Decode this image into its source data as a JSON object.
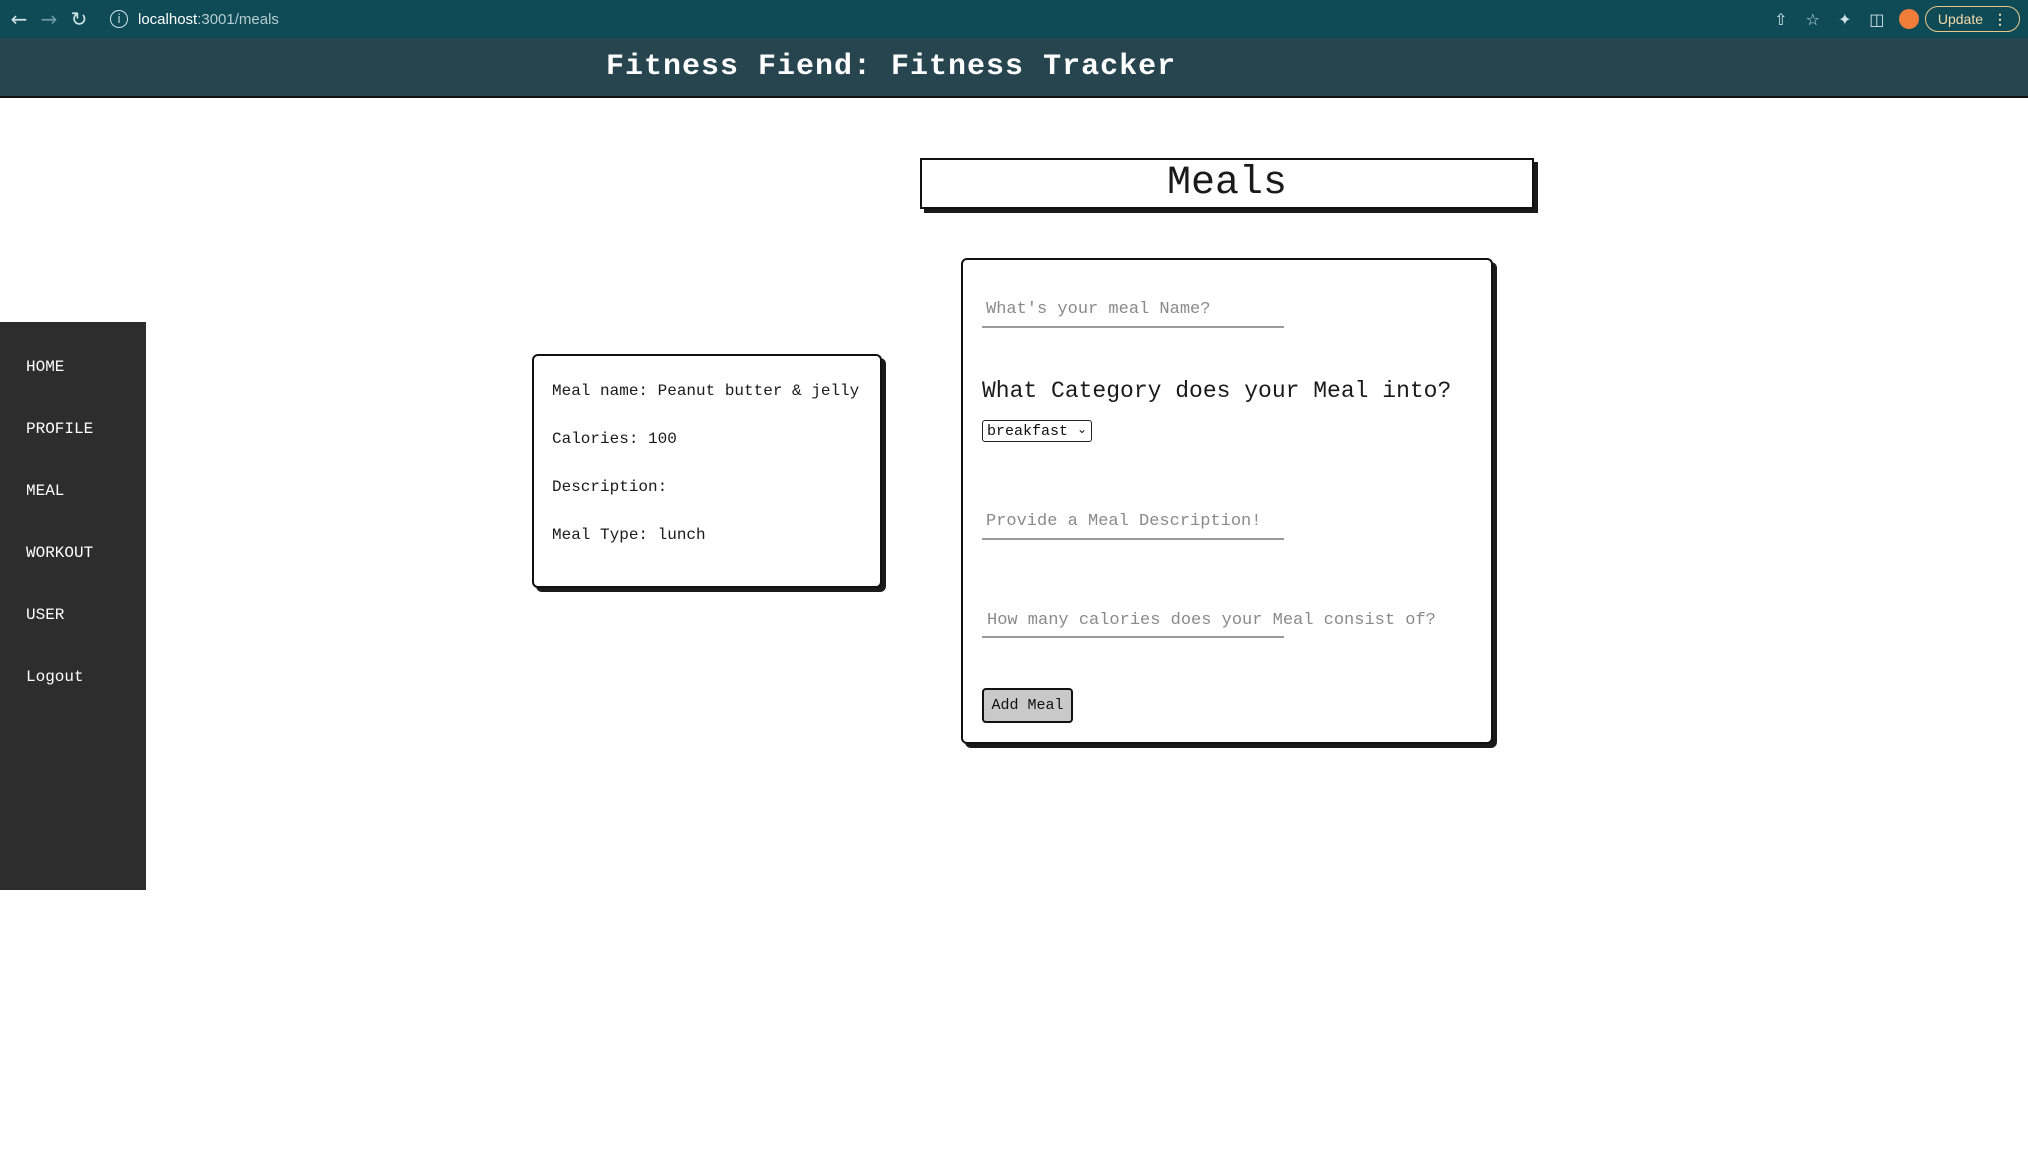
{
  "browser": {
    "url_host": "localhost",
    "url_path": ":3001/meals",
    "update_label": "Update"
  },
  "app": {
    "title": "Fitness Fiend: Fitness Tracker"
  },
  "sidebar": {
    "items": [
      {
        "label": "HOME"
      },
      {
        "label": "PROFILE"
      },
      {
        "label": "MEAL"
      },
      {
        "label": "WORKOUT"
      },
      {
        "label": "USER"
      },
      {
        "label": "Logout"
      }
    ]
  },
  "page": {
    "heading": "Meals"
  },
  "meal_card": {
    "name_line": "Meal name: Peanut butter & jelly",
    "calories_line": "Calories: 100",
    "description_line": "Description:",
    "type_line": "Meal Type: lunch"
  },
  "form": {
    "name_placeholder": "What's your meal Name?",
    "category_label": "What Category does your Meal into?",
    "category_selected": "breakfast",
    "description_placeholder": "Provide a Meal Description!",
    "calories_placeholder": "How many calories does your Meal consist of?",
    "submit_label": "Add Meal"
  }
}
